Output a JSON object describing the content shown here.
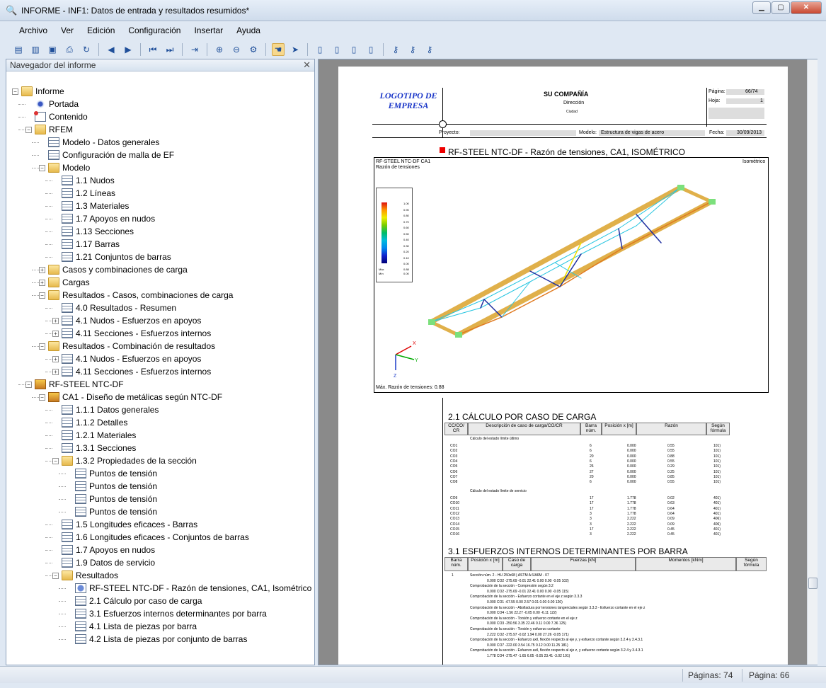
{
  "window": {
    "title": "INFORME - INF1: Datos de entrada y resultados resumidos*"
  },
  "menu": [
    "Archivo",
    "Ver",
    "Edición",
    "Configuración",
    "Insertar",
    "Ayuda"
  ],
  "navigator": {
    "title": "Navegador del informe",
    "nodes": [
      {
        "label": "Informe",
        "icon": "folder-icon"
      },
      {
        "label": "Portada",
        "icon": "eye-icon"
      },
      {
        "label": "Contenido",
        "icon": "contents-icon"
      },
      {
        "label": "RFEM",
        "icon": "folder-icon"
      },
      {
        "label": "Modelo - Datos generales",
        "icon": "table-icon"
      },
      {
        "label": "Configuración de malla de EF",
        "icon": "table-icon"
      },
      {
        "label": "Modelo",
        "icon": "folder-icon"
      },
      {
        "label": "1.1 Nudos",
        "icon": "table-icon"
      },
      {
        "label": "1.2 Líneas",
        "icon": "table-icon"
      },
      {
        "label": "1.3 Materiales",
        "icon": "table-icon"
      },
      {
        "label": "1.7 Apoyos en nudos",
        "icon": "table-icon"
      },
      {
        "label": "1.13 Secciones",
        "icon": "table-icon"
      },
      {
        "label": "1.17 Barras",
        "icon": "table-icon"
      },
      {
        "label": "1.21 Conjuntos de barras",
        "icon": "table-icon"
      },
      {
        "label": "Casos y combinaciones de carga",
        "icon": "folder-icon"
      },
      {
        "label": "Cargas",
        "icon": "folder-icon"
      },
      {
        "label": "Resultados - Casos, combinaciones de carga",
        "icon": "folder-icon"
      },
      {
        "label": "4.0 Resultados - Resumen",
        "icon": "table-icon"
      },
      {
        "label": "4.1 Nudos - Esfuerzos en apoyos",
        "icon": "table-icon"
      },
      {
        "label": "4.11 Secciones - Esfuerzos internos",
        "icon": "table-icon"
      },
      {
        "label": "Resultados - Combinación de resultados",
        "icon": "folder-icon"
      },
      {
        "label": "4.1 Nudos - Esfuerzos en apoyos",
        "icon": "table-icon"
      },
      {
        "label": "4.11 Secciones - Esfuerzos internos",
        "icon": "table-icon"
      },
      {
        "label": "RF-STEEL NTC-DF",
        "icon": "steel-module-icon"
      },
      {
        "label": "CA1 - Diseño de metálicas según NTC-DF",
        "icon": "steel-case-icon"
      },
      {
        "label": "1.1.1 Datos generales",
        "icon": "table-icon"
      },
      {
        "label": "1.1.2 Detalles",
        "icon": "table-icon"
      },
      {
        "label": "1.2.1 Materiales",
        "icon": "table-icon"
      },
      {
        "label": "1.3.1 Secciones",
        "icon": "table-icon"
      },
      {
        "label": "1.3.2 Propiedades de la sección",
        "icon": "folder-icon"
      },
      {
        "label": "Puntos de tensión",
        "icon": "table-icon"
      },
      {
        "label": "Puntos de tensión",
        "icon": "table-icon"
      },
      {
        "label": "Puntos de tensión",
        "icon": "table-icon"
      },
      {
        "label": "Puntos de tensión",
        "icon": "table-icon"
      },
      {
        "label": "1.5 Longitudes eficaces - Barras",
        "icon": "table-icon"
      },
      {
        "label": "1.6 Longitudes eficaces - Conjuntos de barras",
        "icon": "table-icon"
      },
      {
        "label": "1.7 Apoyos en nudos",
        "icon": "table-icon"
      },
      {
        "label": "1.9 Datos de servicio",
        "icon": "table-icon"
      },
      {
        "label": "Resultados",
        "icon": "folder-icon"
      },
      {
        "label": "RF-STEEL NTC-DF -  Razón de tensiones, CA1, Isométrico",
        "icon": "graphic-icon"
      },
      {
        "label": "2.1 Cálculo por caso de carga",
        "icon": "table-icon"
      },
      {
        "label": "3.1 Esfuerzos internos determinantes por barra",
        "icon": "table-icon"
      },
      {
        "label": "4.1 Lista de piezas por barra",
        "icon": "table-icon"
      },
      {
        "label": "4.2 Lista de piezas por conjunto de barras",
        "icon": "table-icon"
      }
    ]
  },
  "report": {
    "logo": "LOGOTIPO DE EMPRESA",
    "company": "SU COMPAÑÍA",
    "direction": "Dirección",
    "city": "Ciudad",
    "page_label": "Página:",
    "page_value": "66/74",
    "sheet_label": "Hoja:",
    "sheet_value": "1",
    "project_label": "Proyecto:",
    "model_label": "Modelo:",
    "model_value": "Estructura de vigas de acero",
    "date_label": "Fecha:",
    "date_value": "30/09/2013",
    "figure_title": "RF-STEEL NTC-DF -  Razón de tensiones, CA1, ISOMÉTRICO",
    "figure_sub1": "RF-STEEL NTC-DF CA1",
    "figure_sub2": "Razón de tensiones",
    "figure_view": "Isométrico",
    "figure_max": "Máx. Razón de tensiones: 0.88",
    "legend_max_label": "Máx",
    "legend_min_label": "Mín",
    "legend_max": "0.88",
    "legend_min": "0.00",
    "legend_ticks": [
      "1.00",
      "0.90",
      "0.80",
      "0.70",
      "0.60",
      "0.50",
      "0.40",
      "0.30",
      "0.20",
      "0.10",
      "0.00"
    ],
    "sec21_title": "2.1 CÁLCULO POR CASO DE CARGA",
    "sec21_headers": [
      "CC/CO/ CR",
      "Descripción de caso de carga/CO/CR",
      "Barra núm.",
      "Posición x [m]",
      "Razón",
      "Según fórmula"
    ],
    "sec21_ult": "Cálculo del estado límite último",
    "sec21_serv": "Cálculo del estado límite de servicio",
    "sec21_rows": [
      [
        "CO1",
        "6",
        "0.000",
        "0.55",
        "101)"
      ],
      [
        "CO2",
        "6",
        "0.000",
        "0.55",
        "101)"
      ],
      [
        "CO3",
        "20",
        "0.000",
        "0.88",
        "101)"
      ],
      [
        "CO4",
        "6",
        "0.000",
        "0.55",
        "101)"
      ],
      [
        "CO5",
        "26",
        "0.000",
        "0.29",
        "101)"
      ],
      [
        "CO6",
        "27",
        "0.000",
        "0.25",
        "101)"
      ],
      [
        "CO7",
        "20",
        "0.000",
        "0.85",
        "101)"
      ],
      [
        "CO8",
        "6",
        "0.000",
        "0.55",
        "101)"
      ],
      [
        "CO9",
        "17",
        "1.778",
        "0.02",
        "401)"
      ],
      [
        "CO10",
        "17",
        "1.778",
        "0.63",
        "401)"
      ],
      [
        "CO11",
        "17",
        "1.778",
        "0.64",
        "401)"
      ],
      [
        "CO12",
        "3",
        "1.778",
        "0.64",
        "401)"
      ],
      [
        "CO13",
        "3",
        "2.222",
        "0.09",
        "406)"
      ],
      [
        "CO14",
        "3",
        "2.222",
        "0.09",
        "406)"
      ],
      [
        "CO15",
        "17",
        "2.222",
        "0.45",
        "401)"
      ],
      [
        "CO16",
        "3",
        "2.222",
        "0.45",
        "401)"
      ]
    ],
    "sec31_title": "3.1 ESFUERZOS INTERNOS DETERMINANTES POR BARRA",
    "sec31_headers": [
      "Barra núm.",
      "Posición x [m]",
      "Caso de carga",
      "Fuerzas [kN]",
      "Momentos [kNm]",
      "Según fórmula"
    ],
    "sec31_bar": "1",
    "sec31_rows": [
      "Sección núm. 2 - HU 250x68 | ASTM A 6/A6M - 07",
      "0.000   CO2   -275.69   -0.01   22.41   0.00   0.00   -0.05   102)",
      "Comprobación de la sección - Compresión según 3.2",
      "0.000   CO2   -275.69   -0.01   22.41   0.00   0.00   -0.05   115)",
      "Comprobación de la sección - Esfuerzo cortante en el eje z según 3.3.3",
      "0.000   CO1   -67.55   0.00   2.57   0.01   0.00   0.00   126)",
      "Comprobación de la sección - Abolladura por tensiones tangenciales según 3.3.3 - Esfuerzo cortante en el eje z",
      "0.000   CO4   -1.56   22.27   -0.05   0.00   -6.11   122)",
      "Comprobación de la sección - Torsión y esfuerzo cortante en el eje z",
      "0.000   CO3   -250.56   3.35   22.46   0.11   0.00   7.36   125)",
      "Comprobación de la sección - Torsión y esfuerzo cortante",
      "2.222   CO2   -275.97   -0.02   1.94   0.00   27.26   -0.05   171)",
      "Comprobación de la sección - Esfuerzo axil, flexión respecto al eje y, y esfuerzo cortante según 3.2.4 y 3.4.3.1",
      "0.000   CO7   -222.00   3.54   16.75   0.12   0.00   11.25   181)",
      "Comprobación de la sección - Esfuerzo axil, flexión respecto al eje z, y esfuerzo cortante según 3.2.4 y 3.4.3.1",
      "1.778   CO4   -275.47   -1.65   6.05   -0.05   23.41   -3.02   191)"
    ]
  },
  "status": {
    "pages_label": "Páginas: 74",
    "page_label": "Página: 66"
  }
}
